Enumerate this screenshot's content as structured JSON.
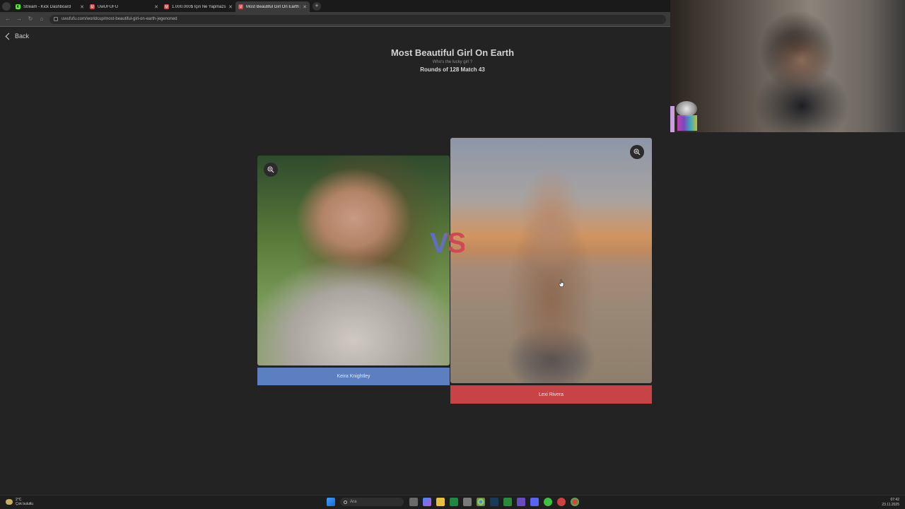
{
  "browser": {
    "tabs": [
      {
        "label": "Stream - Kick Dashboard",
        "favicon": "kick-icon",
        "color": "#53fc18",
        "active": false
      },
      {
        "label": "UwUFUFU",
        "favicon": "uwufufu-icon",
        "color": "#d94a4a",
        "active": false
      },
      {
        "label": "1.000.000$ İçin Ne Yapmazsın |",
        "favicon": "uwufufu-icon",
        "color": "#d94a4a",
        "active": false
      },
      {
        "label": "Most Beautiful Girl On Earth |",
        "favicon": "uwufufu-icon",
        "color": "#d94a4a",
        "active": true
      }
    ],
    "url": "uwufufu.com/worldcup/most-beautiful-girl-on-earth-jegenoned"
  },
  "page": {
    "back_label": "Back",
    "title": "Most Beautiful Girl On Earth",
    "subtitle": "Who's the lucky girl ?",
    "round_info": "Rounds of 128 Match 43",
    "vs_label": "VS"
  },
  "contestants": {
    "left": {
      "name": "Keira Knightley",
      "bar_color": "#5b7fc0"
    },
    "right": {
      "name": "Lexi Rivera",
      "bar_color": "#c84346"
    }
  },
  "taskbar": {
    "weather_temp": "2°C",
    "weather_desc": "Çok bulutlu",
    "search_placeholder": "Ara",
    "time": "07:42",
    "date": "23.11.2025"
  }
}
